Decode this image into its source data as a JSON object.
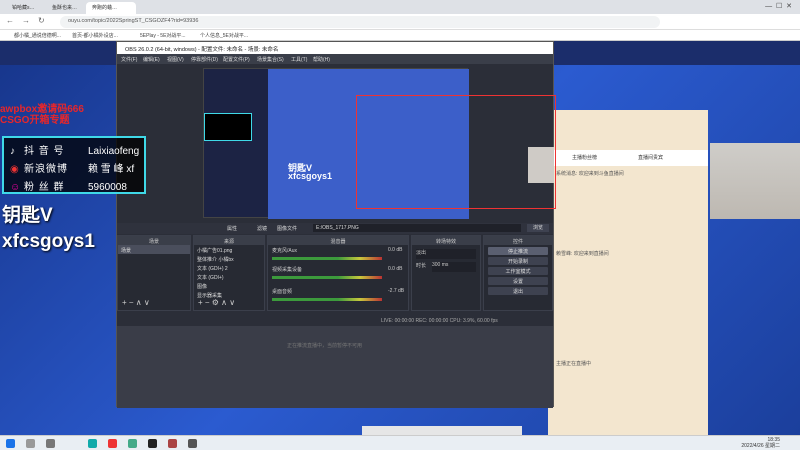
{
  "browser": {
    "tabs": [
      {
        "label": "铂哈藏s…",
        "active": false
      },
      {
        "label": "鱼酥也来…",
        "active": false
      },
      {
        "label": "奔跑的蛐…",
        "active": true
      }
    ],
    "url": "ouyu.com/topic/2022SpringST_CSGOZF4?rid=93936",
    "bookmarks": [
      "都小橘_通说倍德啊...",
      "首页-都小橘外设店...",
      "5EPlay - 5E对战平...",
      "个人信息_5E对战平..."
    ]
  },
  "overlay": {
    "title_line1": "awpbox邀请码666",
    "title_line2": "CSGO开箱专题",
    "info": [
      {
        "icon": "douyin-icon",
        "label": "抖 音 号",
        "value": "Laixiaofeng"
      },
      {
        "icon": "weibo-icon",
        "label": "新浪微博",
        "value": "赖 雪 峰 xf"
      },
      {
        "icon": "fans-icon",
        "label": "粉 丝 群",
        "value": "5960008"
      }
    ],
    "big_line1": "钥匙V",
    "big_line2": "xfcsgoys1"
  },
  "obs": {
    "window_title": "OBS 26.0.2 (64-bit, windows) - 配置文件: 未命名 - 场景: 未命名",
    "menu": [
      "文件(F)",
      "编辑(E)",
      "视图(V)",
      "停靠部件(D)",
      "配置文件(P)",
      "场景集合(S)",
      "工具(T)",
      "帮助(H)"
    ],
    "preview_text1": "钥匙V",
    "preview_text2": "xfcsgoys1",
    "props_bar": {
      "props": "属性",
      "filters": "滤镜",
      "image_file_label": "图像文件",
      "file": "E:/OBS_1717.PNG",
      "browse": "浏览"
    },
    "docks": {
      "scenes": {
        "title": "场景",
        "items": [
          "场景"
        ]
      },
      "sources": {
        "title": "来源",
        "items": [
          "小橘广告01.png",
          "整体推介 小橘bx",
          "文本 (GDI+) 2",
          "文本 (GDI+)",
          "图像",
          "显示器采集"
        ]
      },
      "mixer": {
        "title": "混音器",
        "channels": [
          {
            "name": "麦克风/Aux",
            "db": "0.0 dB"
          },
          {
            "name": "视频采集设备",
            "db": "0.0 dB"
          },
          {
            "name": "桌面音频",
            "db": "-2.7 dB"
          }
        ]
      },
      "transitions": {
        "title": "转场特效",
        "type": "淡出",
        "duration_label": "时长",
        "duration": "300 ms"
      },
      "controls": {
        "title": "控件",
        "buttons": [
          "停止推流",
          "开始录制",
          "工作室模式",
          "设置",
          "退出"
        ]
      }
    },
    "status": "LIVE: 00:00:00   REC: 00:00:00   CPU: 3.9%, 60.00 fps",
    "lower_note": "正在推流直播中，当前暂停不可用"
  },
  "webpage": {
    "chat_tabs": [
      "主播粉丝榜",
      "直播间贵宾"
    ],
    "chat": [
      "系统消息: 欢迎来到斗鱼直播间",
      "赖雪峰: 欢迎来到直播间",
      "主播正在直播中"
    ]
  },
  "taskbar": {
    "time": "18:35",
    "date": "2022/4/26 星期二"
  }
}
